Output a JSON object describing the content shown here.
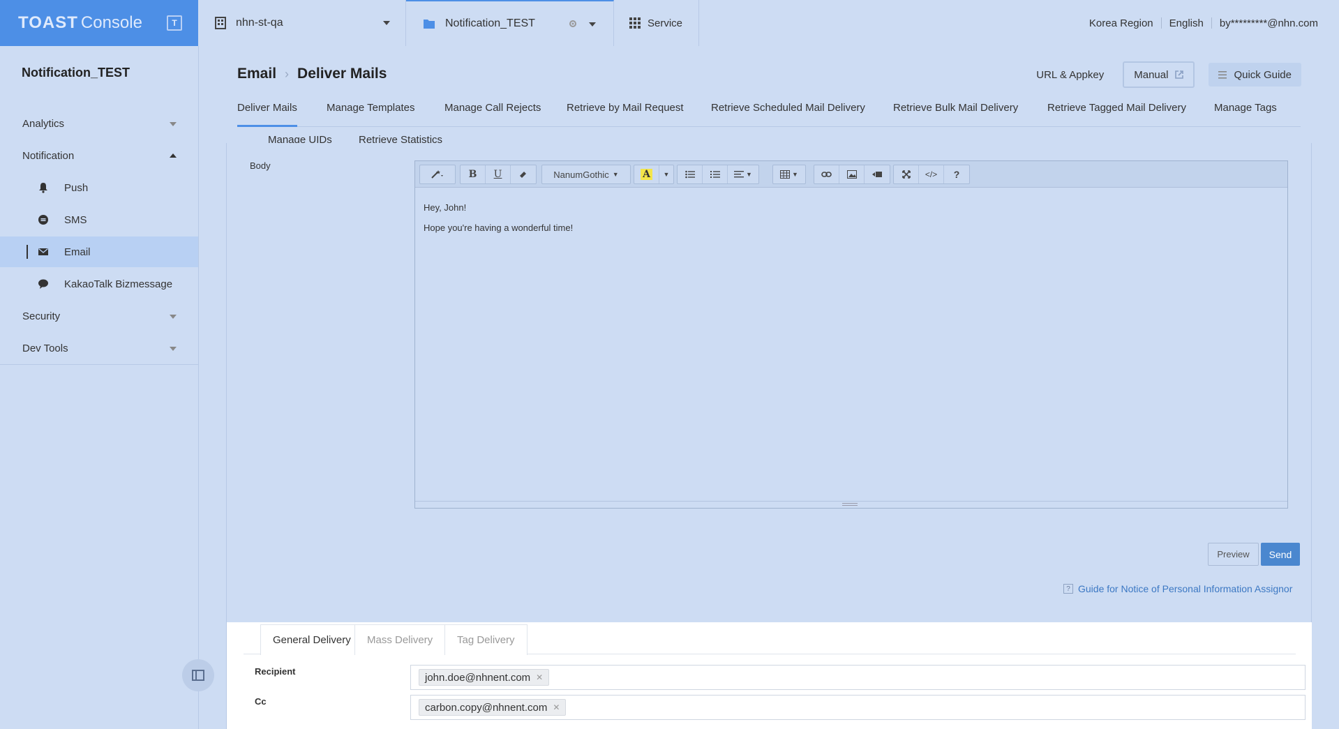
{
  "topbar": {
    "brand_logo": "TOAST",
    "brand_console": "Console",
    "org_name": "nhn-st-qa",
    "project_name": "Notification_TEST",
    "service_label": "Service",
    "region": "Korea Region",
    "language": "English",
    "user": "by*********@nhn.com"
  },
  "sidebar": {
    "title": "Notification_TEST",
    "items": [
      {
        "label": "Analytics"
      },
      {
        "label": "Notification"
      },
      {
        "label": "Push"
      },
      {
        "label": "SMS"
      },
      {
        "label": "Email"
      },
      {
        "label": "KakaoTalk Bizmessage"
      },
      {
        "label": "Security"
      },
      {
        "label": "Dev Tools"
      }
    ]
  },
  "header": {
    "crumb_root": "Email",
    "crumb_current": "Deliver Mails",
    "url_appkey": "URL & Appkey",
    "manual": "Manual",
    "quick_guide": "Quick Guide"
  },
  "tabs": [
    "Deliver Mails",
    "Manage Templates",
    "Manage Call Rejects",
    "Retrieve by Mail Request",
    "Retrieve Scheduled Mail Delivery",
    "Retrieve Bulk Mail Delivery",
    "Retrieve Tagged Mail Delivery",
    "Manage Tags",
    "Manage UIDs",
    "Retrieve Statistics"
  ],
  "editor": {
    "label": "Body",
    "font_name": "NanumGothic",
    "line1": "Hey, John!",
    "line2": "Hope you're having a wonderful time!"
  },
  "actions": {
    "preview": "Preview",
    "send": "Send",
    "guide": "Guide for Notice of Personal Information Assignor"
  },
  "delivery": {
    "tabs": [
      "General Delivery",
      "Mass Delivery",
      "Tag Delivery"
    ],
    "recipient_label": "Recipient",
    "recipient_value": "john.doe@nhnent.com",
    "cc_label": "Cc",
    "cc_value": "carbon.copy@nhnent.com"
  },
  "colors": {
    "accent": "#4d8fe6",
    "send": "#4a87cf",
    "link": "#3c78c3"
  }
}
